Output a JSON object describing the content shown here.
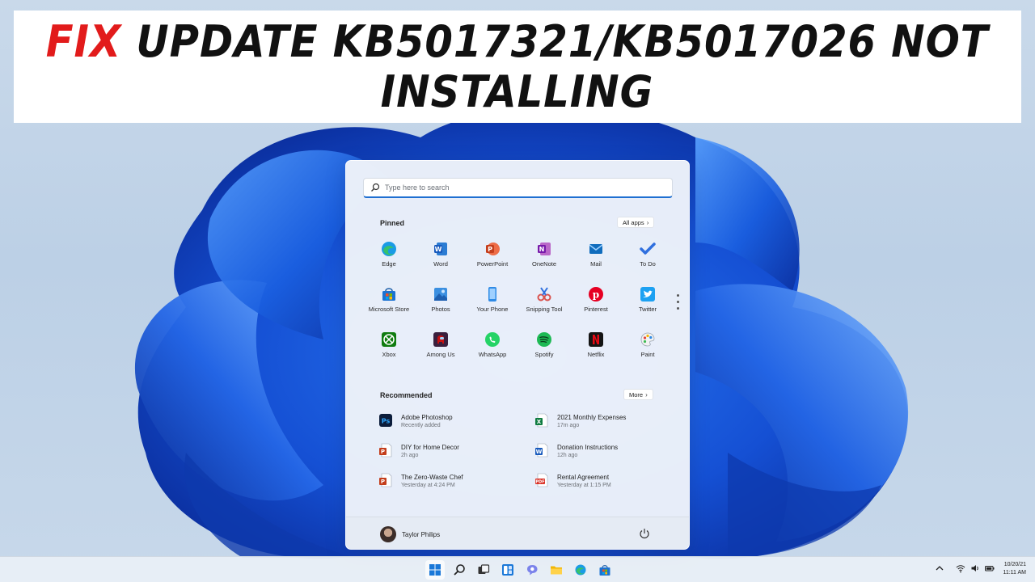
{
  "banner": {
    "fix_word": "FIX",
    "line1_rest": " UPDATE KB5017321/KB5017026 NOT",
    "line2": "INSTALLING"
  },
  "colors": {
    "banner_accent": "#e21b1b",
    "bloom_blue": "#1a5fe0",
    "search_underline": "#1f6fd1"
  },
  "start_menu": {
    "search": {
      "placeholder": "Type here to search",
      "icon": "search-icon"
    },
    "pinned": {
      "title": "Pinned",
      "all_apps_label": "All apps",
      "apps": [
        {
          "label": "Edge",
          "icon": "edge-icon"
        },
        {
          "label": "Word",
          "icon": "word-icon"
        },
        {
          "label": "PowerPoint",
          "icon": "powerpoint-icon"
        },
        {
          "label": "OneNote",
          "icon": "onenote-icon"
        },
        {
          "label": "Mail",
          "icon": "mail-icon"
        },
        {
          "label": "To Do",
          "icon": "todo-icon"
        },
        {
          "label": "Microsoft Store",
          "icon": "store-icon"
        },
        {
          "label": "Photos",
          "icon": "photos-icon"
        },
        {
          "label": "Your Phone",
          "icon": "phone-icon"
        },
        {
          "label": "Snipping Tool",
          "icon": "snipping-tool-icon"
        },
        {
          "label": "Pinterest",
          "icon": "pinterest-icon"
        },
        {
          "label": "Twitter",
          "icon": "twitter-icon"
        },
        {
          "label": "Xbox",
          "icon": "xbox-icon"
        },
        {
          "label": "Among Us",
          "icon": "among-us-icon"
        },
        {
          "label": "WhatsApp",
          "icon": "whatsapp-icon"
        },
        {
          "label": "Spotify",
          "icon": "spotify-icon"
        },
        {
          "label": "Netflix",
          "icon": "netflix-icon"
        },
        {
          "label": "Paint",
          "icon": "paint-icon"
        }
      ]
    },
    "recommended": {
      "title": "Recommended",
      "more_label": "More",
      "items": [
        {
          "name": "Adobe Photoshop",
          "time": "Recently added",
          "icon": "photoshop-icon"
        },
        {
          "name": "2021 Monthly Expenses",
          "time": "17m ago",
          "icon": "excel-icon"
        },
        {
          "name": "DIY for Home Decor",
          "time": "2h ago",
          "icon": "powerpoint-file-icon"
        },
        {
          "name": "Donation Instructions",
          "time": "12h ago",
          "icon": "word-file-icon"
        },
        {
          "name": "The Zero-Waste Chef",
          "time": "Yesterday at 4:24 PM",
          "icon": "powerpoint-file-icon"
        },
        {
          "name": "Rental Agreement",
          "time": "Yesterday at 1:15 PM",
          "icon": "pdf-file-icon"
        }
      ]
    },
    "user": {
      "name": "Taylor Philips"
    }
  },
  "taskbar": {
    "icons": [
      "start-icon",
      "search-icon",
      "task-view-icon",
      "widgets-icon",
      "chat-icon",
      "file-explorer-icon",
      "edge-icon",
      "store-icon"
    ],
    "tray": [
      "chevron-up-icon",
      "wifi-icon",
      "volume-icon",
      "battery-icon"
    ],
    "date": "10/20/21",
    "time": "11:11 AM"
  }
}
